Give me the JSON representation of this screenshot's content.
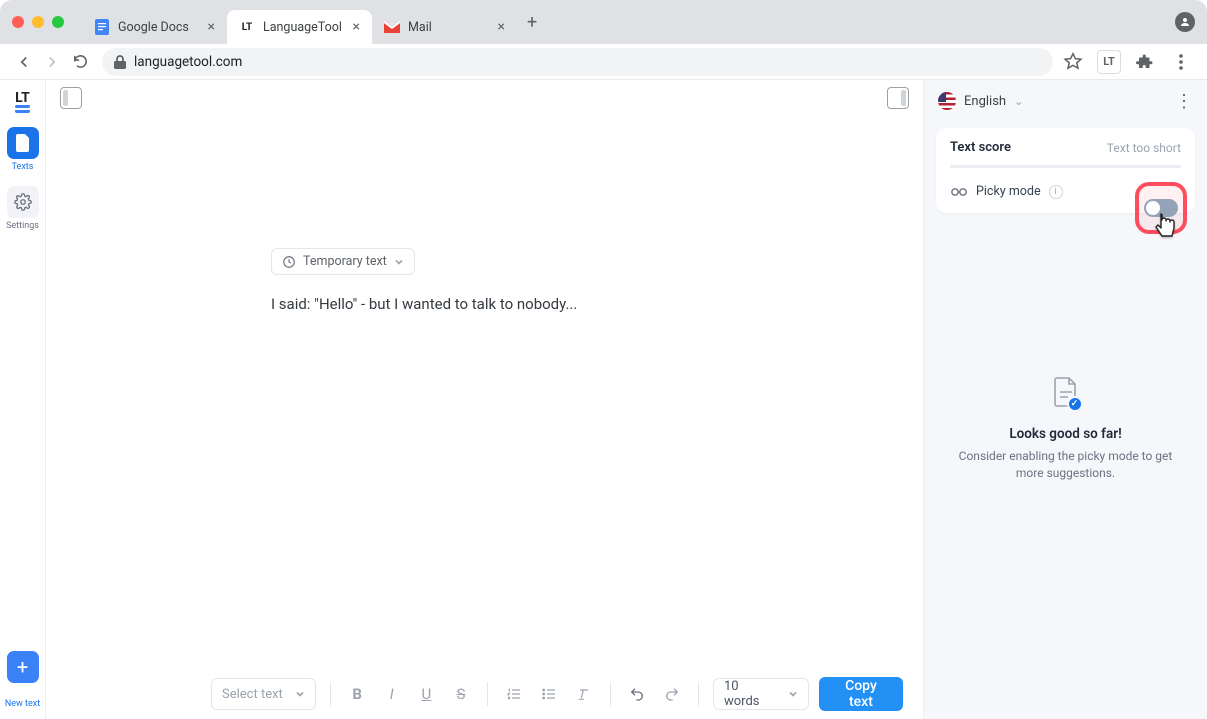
{
  "browser": {
    "tabs": [
      {
        "label": "Google Docs"
      },
      {
        "label": "LanguageTool"
      },
      {
        "label": "Mail"
      }
    ],
    "url": "languagetool.com"
  },
  "leftRail": {
    "texts": "Texts",
    "settings": "Settings",
    "newText": "New text"
  },
  "editor": {
    "docTitle": "Temporary text",
    "content": "I said: \"Hello\" - but I wanted to talk to nobody..."
  },
  "toolbar": {
    "selectText": "Select text",
    "wordCount": "10 words",
    "copy": "Copy text"
  },
  "rightPanel": {
    "language": "English",
    "scoreTitle": "Text score",
    "scoreStatus": "Text too short",
    "pickyLabel": "Picky mode",
    "emptyTitle": "Looks good so far!",
    "emptySub": "Consider enabling the picky mode to get more suggestions."
  }
}
